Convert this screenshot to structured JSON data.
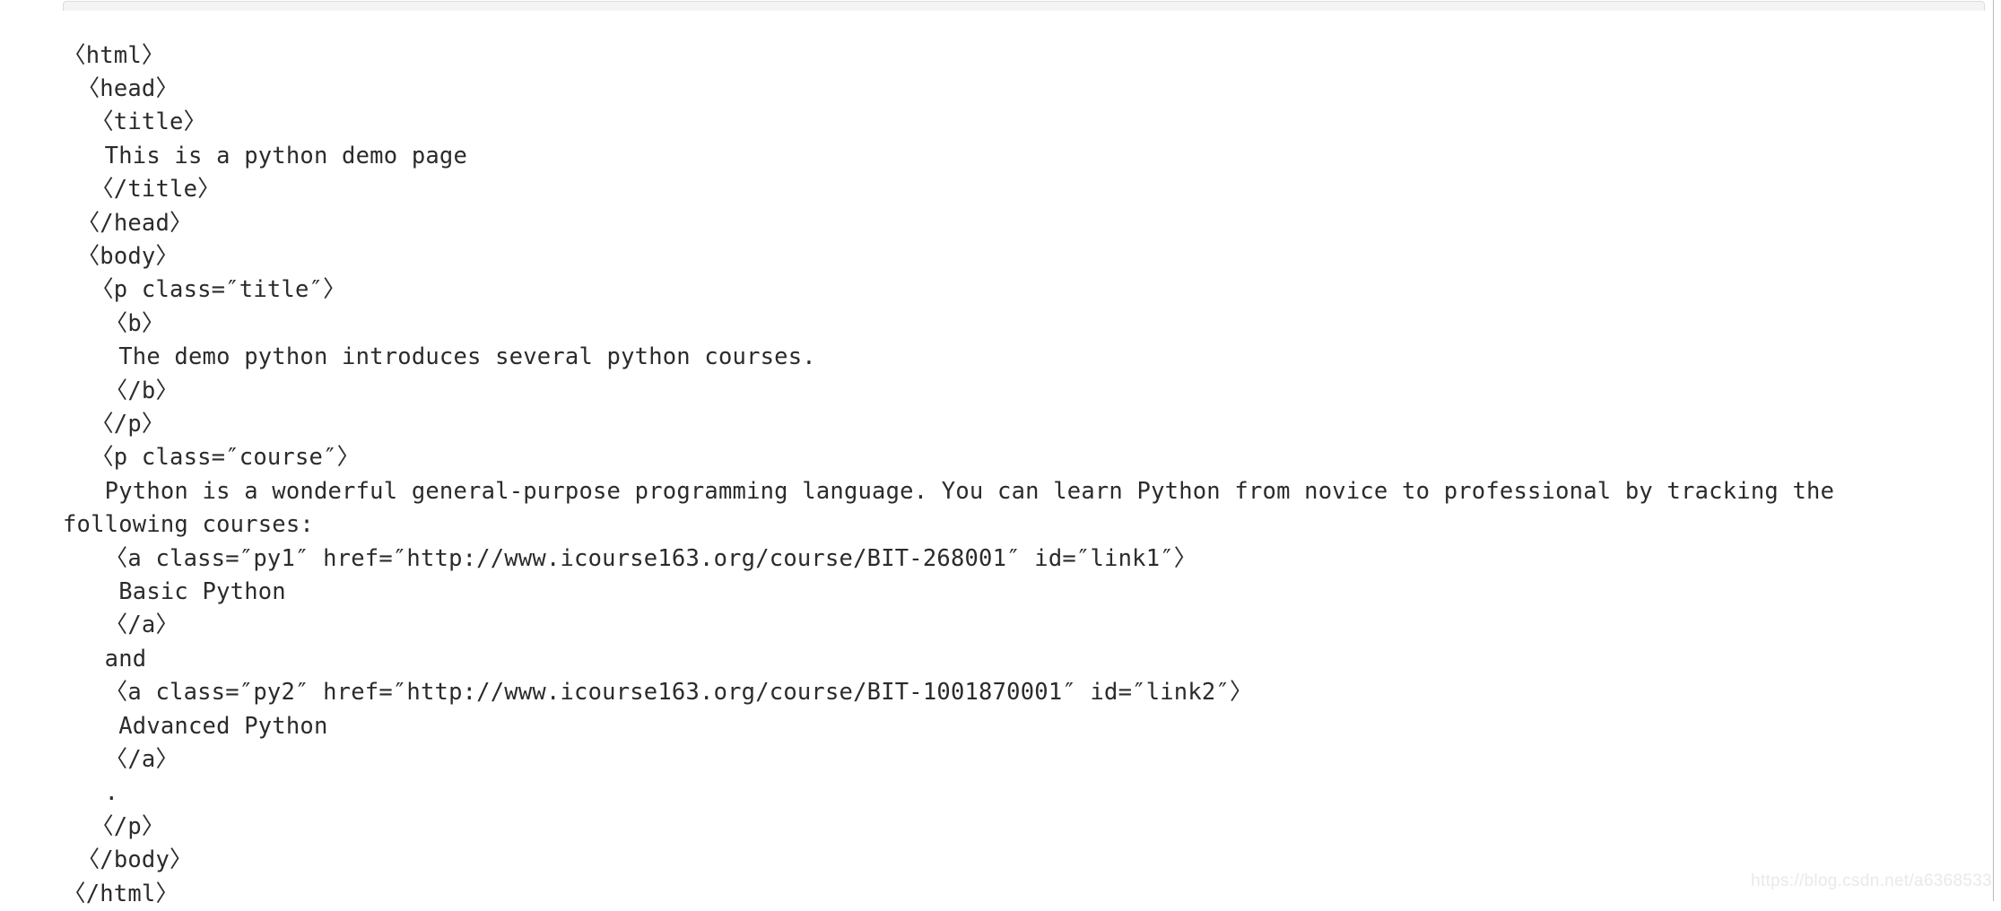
{
  "window": {
    "top_strip_color": "#f4f4f4",
    "top_strip_border_color": "#dcdcdc",
    "background_color": "#ffffff",
    "text_color": "#2b2b2b",
    "right_rule_color": "#b9b9b9"
  },
  "code_block": {
    "language": "html",
    "description": "BeautifulSoup prettify() output of a python demo page",
    "lines": [
      "〈html〉",
      " 〈head〉",
      "  〈title〉",
      "   This is a python demo page",
      "  〈/title〉",
      " 〈/head〉",
      " 〈body〉",
      "  〈p class=″title″〉",
      "   〈b〉",
      "    The demo python introduces several python courses.",
      "   〈/b〉",
      "  〈/p〉",
      "  〈p class=″course″〉",
      "   Python is a wonderful general-purpose programming language. You can learn Python from novice to professional by tracking the following courses:",
      "   〈a class=″py1″ href=″http://www.icourse163.org/course/BIT-268001″ id=″link1″〉",
      "    Basic Python",
      "   〈/a〉",
      "   and",
      "   〈a class=″py2″ href=″http://www.icourse163.org/course/BIT-1001870001″ id=″link2″〉",
      "    Advanced Python",
      "   〈/a〉",
      "   .",
      "  〈/p〉",
      " 〈/body〉",
      "〈/html〉"
    ]
  },
  "watermark": {
    "text": "https://blog.csdn.net/a6368533"
  }
}
